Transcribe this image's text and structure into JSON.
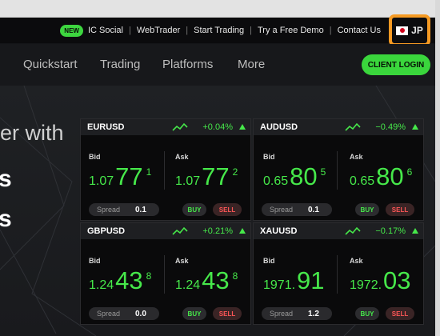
{
  "utility_bar": {
    "new_badge": "NEW",
    "links": [
      "IC Social",
      "WebTrader",
      "Start Trading",
      "Try a Free Demo",
      "Contact Us"
    ],
    "language": {
      "code": "JP",
      "flag_icon": "japan-flag-icon"
    }
  },
  "nav": {
    "items": [
      "Quickstart",
      "Trading",
      "Platforms",
      "More"
    ],
    "cta": "CLIENT LOGIN"
  },
  "hero": {
    "line1": "er with",
    "line2": "s",
    "line3": "s"
  },
  "quotes": {
    "spread_label": "Spread",
    "bid_label": "Bid",
    "ask_label": "Ask",
    "buy_label": "BUY",
    "sell_label": "SELL",
    "instruments": [
      {
        "symbol": "EURUSD",
        "change": "+0.04%",
        "direction": "up",
        "bid": {
          "prefix": "1.07",
          "big": "77",
          "pip": "1"
        },
        "ask": {
          "prefix": "1.07",
          "big": "77",
          "pip": "2"
        },
        "spread": "0.1"
      },
      {
        "symbol": "AUDUSD",
        "change": "−0.49%",
        "direction": "up",
        "bid": {
          "prefix": "0.65",
          "big": "80",
          "pip": "5"
        },
        "ask": {
          "prefix": "0.65",
          "big": "80",
          "pip": "6"
        },
        "spread": "0.1"
      },
      {
        "symbol": "GBPUSD",
        "change": "+0.21%",
        "direction": "up",
        "bid": {
          "prefix": "1.24",
          "big": "43",
          "pip": "8"
        },
        "ask": {
          "prefix": "1.24",
          "big": "43",
          "pip": "8"
        },
        "spread": "0.0"
      },
      {
        "symbol": "XAUUSD",
        "change": "−0.17%",
        "direction": "up",
        "bid": {
          "prefix": "1971.",
          "big": "91",
          "pip": ""
        },
        "ask": {
          "prefix": "1972.",
          "big": "03",
          "pip": ""
        },
        "spread": "1.2"
      }
    ]
  },
  "colors": {
    "accent": "#3ad63c",
    "price": "#46e84a",
    "sell": "#ff5656",
    "highlight": "#f59a23"
  }
}
